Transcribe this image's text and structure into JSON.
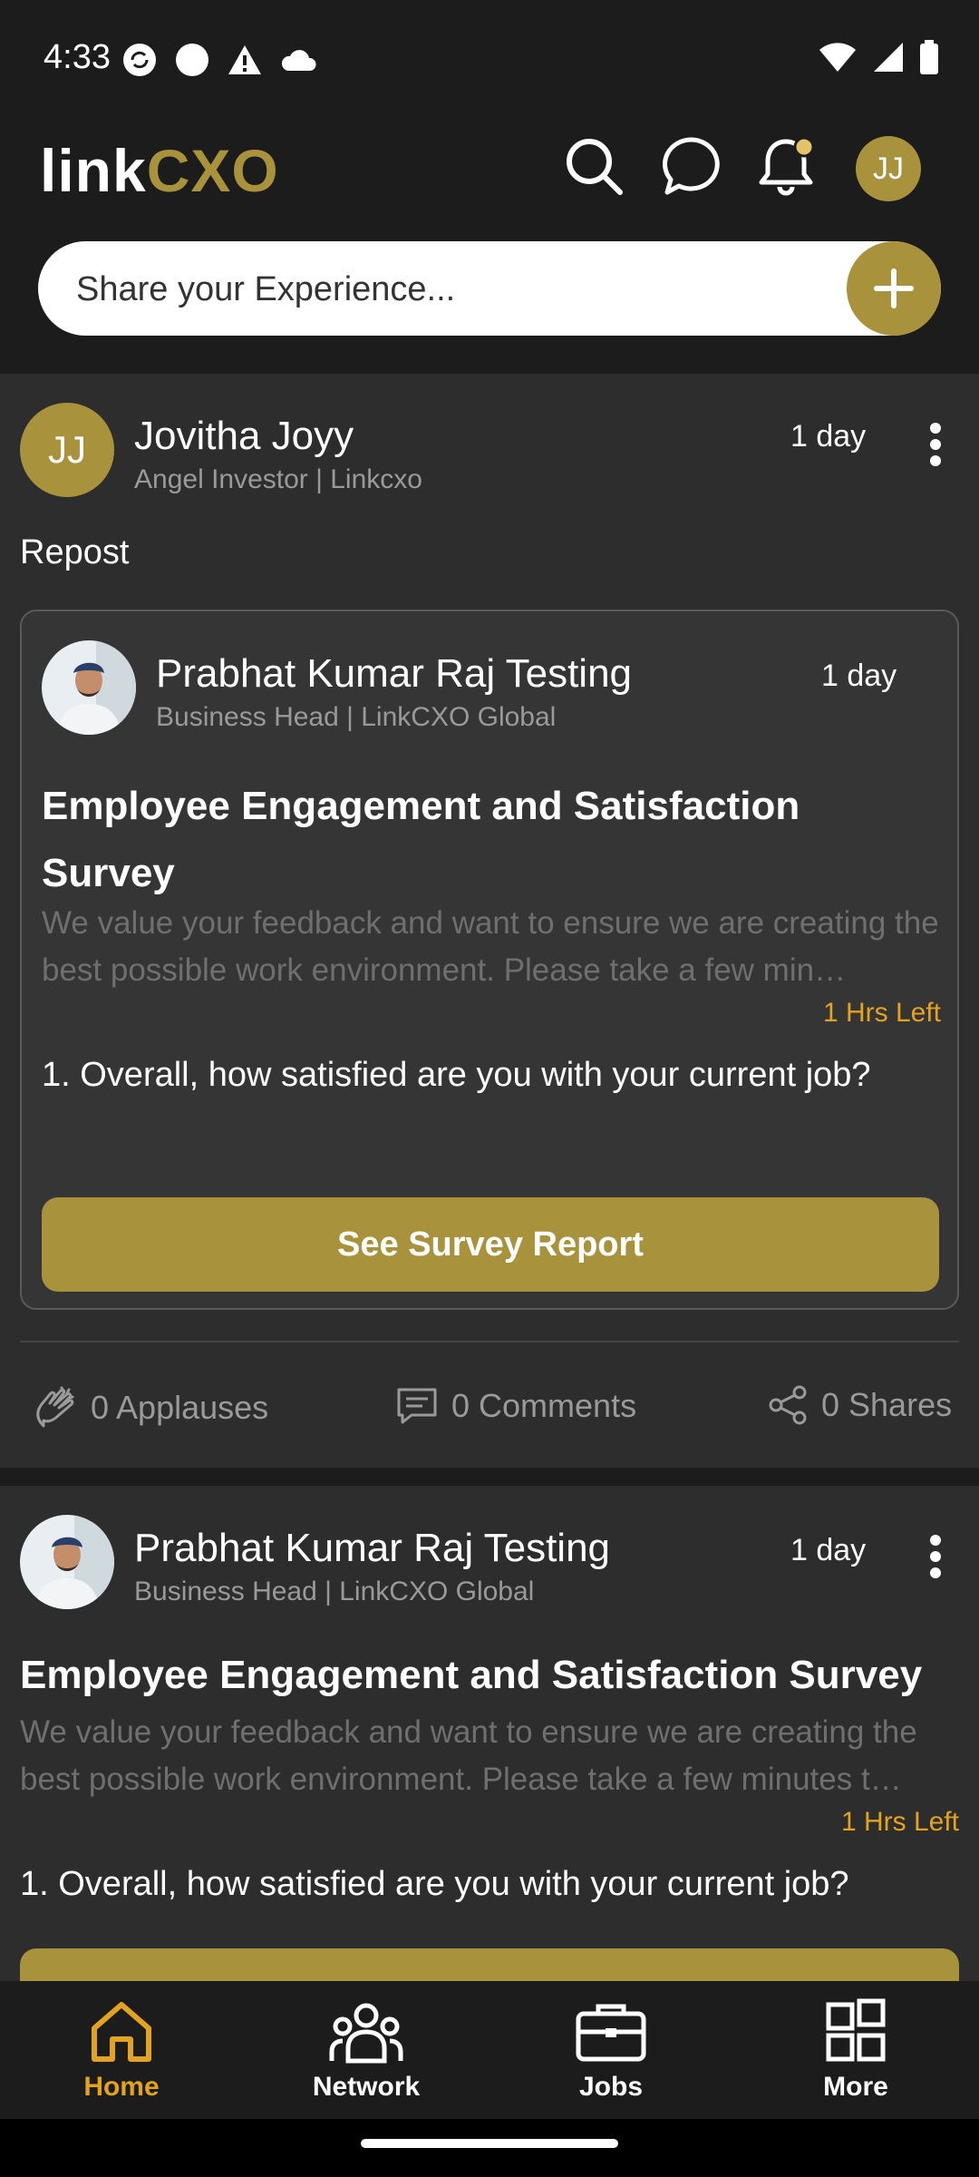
{
  "status_bar": {
    "time": "4:33"
  },
  "header": {
    "logo_link": "link",
    "logo_cxo": "CXO",
    "avatar_initials": "JJ"
  },
  "composer": {
    "placeholder": "Share your Experience..."
  },
  "post1": {
    "author": "Jovitha Joyy",
    "subtitle": "Angel Investor | Linkcxo",
    "avatar_initials": "JJ",
    "time": "1 day",
    "repost_label": "Repost",
    "inner": {
      "author": "Prabhat Kumar Raj Testing",
      "subtitle": "Business Head | LinkCXO Global",
      "time": "1 day",
      "title": "Employee Engagement and Satisfaction Survey",
      "description": "We value your feedback and want to ensure we are creating the best possible work environment. Please take a few min…",
      "hrs_left": "1 Hrs Left",
      "question": "1. Overall, how satisfied are you with your current job?",
      "button": "See Survey Report"
    },
    "applauses": "0 Applauses",
    "comments": "0 Comments",
    "shares": "0 Shares"
  },
  "post2": {
    "author": "Prabhat Kumar Raj Testing",
    "subtitle": "Business Head | LinkCXO Global",
    "time": "1 day",
    "title": "Employee Engagement and Satisfaction Survey",
    "description": "We value your feedback and want to ensure we are creating the best possible work environment. Please take a few minutes t…",
    "hrs_left": "1 Hrs Left",
    "question": "1. Overall, how satisfied are you with your current job?"
  },
  "bottom_nav": {
    "items": [
      {
        "label": "Home",
        "icon": "home-icon",
        "active": true
      },
      {
        "label": "Network",
        "icon": "network-icon",
        "active": false
      },
      {
        "label": "Jobs",
        "icon": "briefcase-icon",
        "active": false
      },
      {
        "label": "More",
        "icon": "grid-icon",
        "active": false
      }
    ]
  },
  "colors": {
    "accent": "#a9923c",
    "warning": "#e4a31f",
    "background": "#1c1c1c",
    "card": "#2d2d2d"
  }
}
